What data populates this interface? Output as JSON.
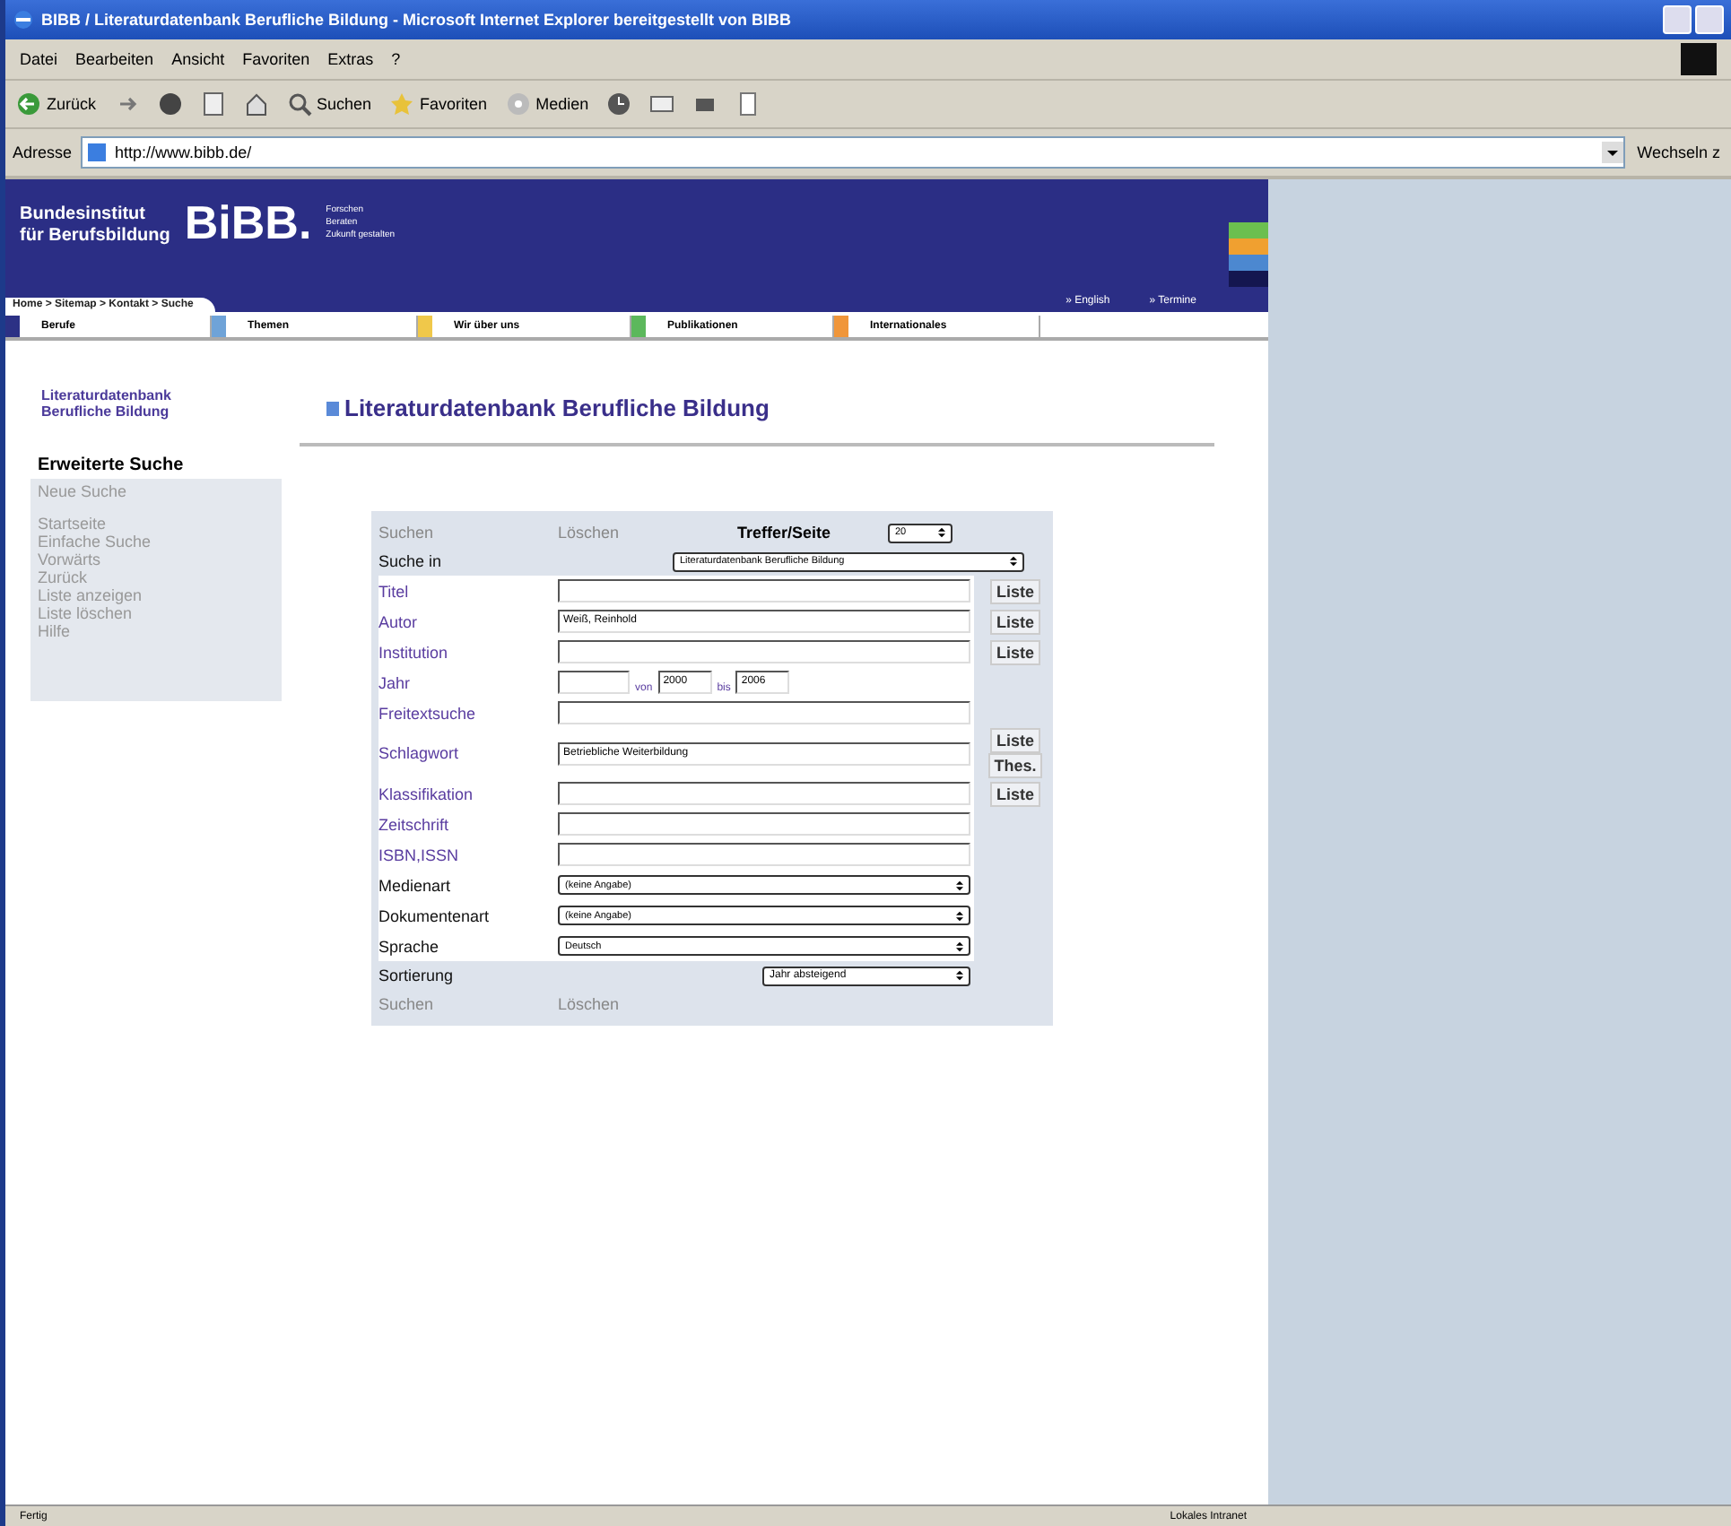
{
  "window": {
    "title": "BIBB / Literaturdatenbank Berufliche Bildung - Microsoft Internet Explorer bereitgestellt von BIBB"
  },
  "menu": [
    "Datei",
    "Bearbeiten",
    "Ansicht",
    "Favoriten",
    "Extras",
    "?"
  ],
  "toolbar": [
    {
      "kind": "back",
      "label": "Zurück"
    },
    {
      "kind": "forward"
    },
    {
      "kind": "stop"
    },
    {
      "kind": "refresh"
    },
    {
      "kind": "home"
    },
    {
      "kind": "search",
      "label": "Suchen"
    },
    {
      "kind": "favorites",
      "label": "Favoriten"
    },
    {
      "kind": "media",
      "label": "Medien"
    },
    {
      "kind": "history"
    },
    {
      "kind": "mail"
    },
    {
      "kind": "print"
    },
    {
      "kind": "edit"
    }
  ],
  "address": {
    "label": "Adresse",
    "value": "http://www.bibb.de/",
    "go": "Wechseln z"
  },
  "header": {
    "institute": [
      "Bundesinstitut",
      "für Berufsbildung"
    ],
    "logo": "BiBB.",
    "tagline": [
      "Forschen",
      "Beraten",
      "Zukunft gestalten"
    ],
    "breadcrumb": "Home > Sitemap > Kontakt > Suche",
    "links": [
      "» English",
      "» Termine"
    ]
  },
  "nav": [
    {
      "label": "Berufe",
      "color": "#2c3185"
    },
    {
      "label": "Themen",
      "color": "#6fa3d8"
    },
    {
      "label": "Wir über uns",
      "color": "#f0c84a"
    },
    {
      "label": "Publikationen",
      "color": "#5cb85c"
    },
    {
      "label": "Internationales",
      "color": "#f0963a"
    }
  ],
  "sidebar": {
    "title": "Literaturdatenbank Berufliche Bildung",
    "section": "Erweiterte Suche",
    "current": "Neue Suche",
    "items": [
      "Startseite",
      "Einfache Suche",
      "Vorwärts",
      "Zurück",
      "Liste anzeigen",
      "Liste löschen",
      "Hilfe"
    ]
  },
  "heading": "Literaturdatenbank Berufliche Bildung",
  "form": {
    "top_actions": [
      "Suchen",
      "Löschen"
    ],
    "hits_label": "Treffer/Seite",
    "hits_value": "20",
    "search_in_label": "Suche in",
    "search_in_value": "Literaturdatenbank Berufliche Bildung",
    "fields": [
      {
        "kind": "text",
        "label": "Titel",
        "buttons": [
          "Liste"
        ]
      },
      {
        "kind": "text",
        "label": "Autor",
        "value": "Weiß, Reinhold",
        "buttons": [
          "Liste"
        ]
      },
      {
        "kind": "text",
        "label": "Institution",
        "buttons": [
          "Liste"
        ]
      },
      {
        "kind": "year",
        "label": "Jahr",
        "from_label": "von",
        "from": "2000",
        "to_label": "bis",
        "to": "2006"
      },
      {
        "kind": "text",
        "label": "Freitextsuche"
      },
      {
        "kind": "text",
        "label": "Schlagwort",
        "value": "Betriebliche Weiterbildung",
        "buttons": [
          "Liste",
          "Thes."
        ]
      },
      {
        "kind": "text",
        "label": "Klassifikation",
        "buttons": [
          "Liste"
        ]
      },
      {
        "kind": "text",
        "label": "Zeitschrift"
      },
      {
        "kind": "text",
        "label": "ISBN,ISSN"
      },
      {
        "kind": "select",
        "label": "Medienart",
        "value": "(keine Angabe)"
      },
      {
        "kind": "select",
        "label": "Dokumentenart",
        "value": "(keine Angabe)"
      },
      {
        "kind": "select",
        "label": "Sprache",
        "value": "Deutsch"
      }
    ],
    "sort_label": "Sortierung",
    "sort_value": "Jahr absteigend",
    "bottom_actions": [
      "Suchen",
      "Löschen"
    ]
  },
  "status_bar": {
    "left": "Fertig",
    "right": "Lokales Intranet"
  }
}
